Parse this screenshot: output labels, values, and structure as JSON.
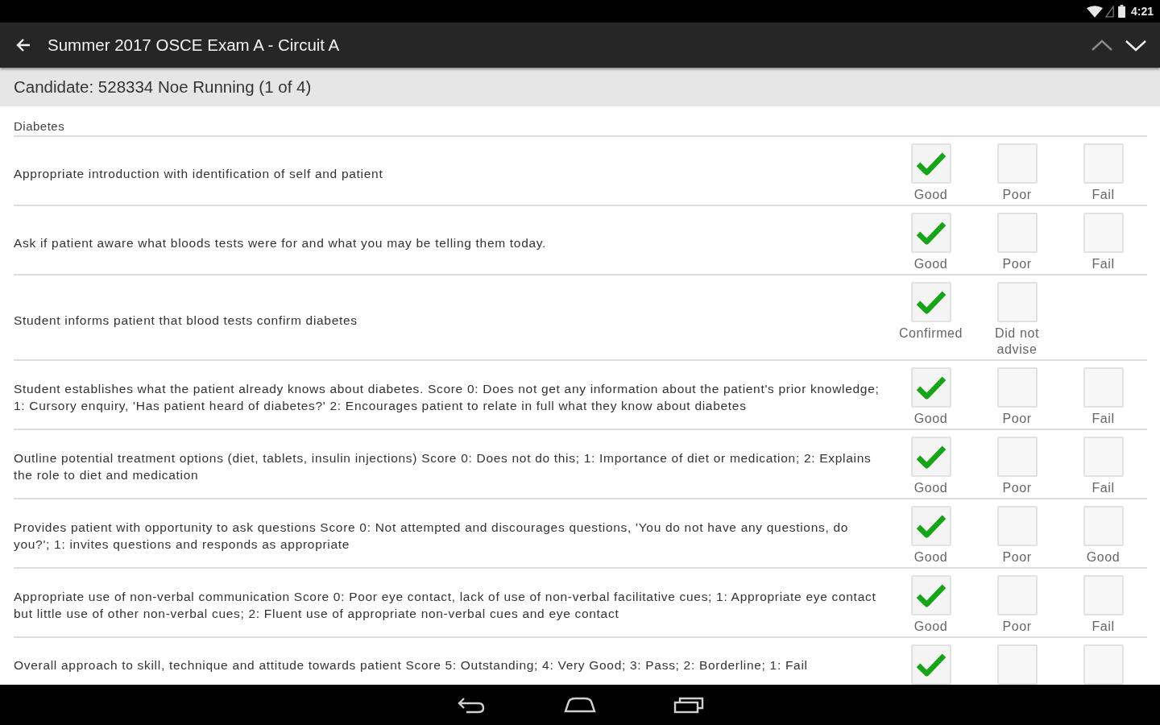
{
  "status_bar": {
    "time": "4:21"
  },
  "app_bar": {
    "title": "Summer 2017 OSCE Exam A - Circuit A",
    "nav_buttons": [
      {
        "kind": "previous",
        "disabled": true
      },
      {
        "kind": "next",
        "disabled": false
      }
    ]
  },
  "candidate": "Candidate: 528334 Noe Running (1 of 4)",
  "section": {
    "title": "Diabetes",
    "items": [
      {
        "text": "Appropriate introduction with identification of self and patient",
        "options": [
          {
            "label": "Good",
            "checked": true
          },
          {
            "label": "Poor",
            "checked": false
          },
          {
            "label": "Fail",
            "checked": false
          }
        ]
      },
      {
        "text": "Ask if patient aware what bloods tests were for and what you may be telling them today.",
        "options": [
          {
            "label": "Good",
            "checked": true
          },
          {
            "label": "Poor",
            "checked": false
          },
          {
            "label": "Fail",
            "checked": false
          }
        ]
      },
      {
        "text": "Student informs patient that blood tests confirm diabetes",
        "options": [
          {
            "label": "Confirmed",
            "checked": true
          },
          {
            "label": "Did not advise",
            "checked": false
          }
        ]
      },
      {
        "text": "Student establishes what the patient already knows about diabetes. Score 0: Does not get any information about the patient's prior knowledge; 1: Cursory enquiry, 'Has patient heard of diabetes?' 2: Encourages patient to relate in full what they know about diabetes",
        "options": [
          {
            "label": "Good",
            "checked": true
          },
          {
            "label": "Poor",
            "checked": false
          },
          {
            "label": "Fail",
            "checked": false
          }
        ]
      },
      {
        "text": "Outline potential treatment options (diet, tablets, insulin injections) Score 0: Does not do this; 1: Importance of diet or medication; 2: Explains the role to diet and medication",
        "options": [
          {
            "label": "Good",
            "checked": true
          },
          {
            "label": "Poor",
            "checked": false
          },
          {
            "label": "Fail",
            "checked": false
          }
        ]
      },
      {
        "text": "Provides patient with opportunity to ask questions Score 0: Not attempted and discourages questions, 'You do not have any questions, do you?'; 1: invites questions and responds as appropriate",
        "options": [
          {
            "label": "Good",
            "checked": true
          },
          {
            "label": "Poor",
            "checked": false
          },
          {
            "label": "Good",
            "checked": false
          }
        ]
      },
      {
        "text": "Appropriate use of non-verbal communication Score 0: Poor eye contact, lack of use of non-verbal facilitative cues; 1: Appropriate eye contact but little use of other non-verbal cues; 2: Fluent use of appropriate non-verbal cues and eye contact",
        "options": [
          {
            "label": "Good",
            "checked": true
          },
          {
            "label": "Poor",
            "checked": false
          },
          {
            "label": "Fail",
            "checked": false
          }
        ]
      },
      {
        "text": "Overall approach to skill, technique and attitude towards patient Score 5: Outstanding; 4: Very Good; 3: Pass; 2: Borderline; 1: Fail",
        "options": [
          {
            "checked": true
          },
          {
            "checked": false
          },
          {
            "checked": false
          }
        ]
      }
    ]
  }
}
